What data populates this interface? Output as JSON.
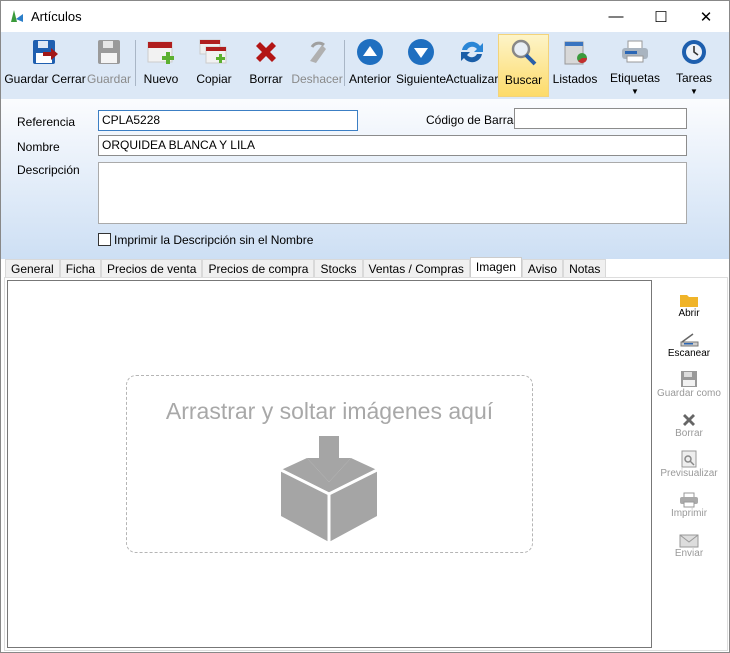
{
  "window": {
    "title": "Artículos",
    "minimize": "—",
    "maximize": "☐",
    "close": "✕"
  },
  "toolbar": [
    {
      "id": "guardar-cerrar",
      "label": "Guardar Cerrar",
      "enabled": true,
      "icon": "save-close-icon"
    },
    {
      "id": "guardar",
      "label": "Guardar",
      "enabled": false,
      "icon": "save-icon"
    },
    {
      "id": "nuevo",
      "label": "Nuevo",
      "enabled": true,
      "icon": "new-icon"
    },
    {
      "id": "copiar",
      "label": "Copiar",
      "enabled": true,
      "icon": "copy-icon"
    },
    {
      "id": "borrar",
      "label": "Borrar",
      "enabled": true,
      "icon": "delete-icon"
    },
    {
      "id": "deshacer",
      "label": "Deshacer",
      "enabled": false,
      "icon": "undo-icon"
    },
    {
      "id": "anterior",
      "label": "Anterior",
      "enabled": true,
      "icon": "arrow-up-icon"
    },
    {
      "id": "siguiente",
      "label": "Siguiente",
      "enabled": true,
      "icon": "arrow-down-icon"
    },
    {
      "id": "actualizar",
      "label": "Actualizar",
      "enabled": true,
      "icon": "refresh-icon"
    },
    {
      "id": "buscar",
      "label": "Buscar",
      "enabled": true,
      "active": true,
      "icon": "search-icon"
    },
    {
      "id": "listados",
      "label": "Listados",
      "enabled": true,
      "icon": "report-icon"
    },
    {
      "id": "etiquetas",
      "label": "Etiquetas",
      "enabled": true,
      "dropdown": true,
      "icon": "printer-icon"
    },
    {
      "id": "tareas",
      "label": "Tareas",
      "enabled": true,
      "dropdown": true,
      "icon": "clock-icon"
    }
  ],
  "form": {
    "referencia_label": "Referencia",
    "referencia_value": "CPLA5228",
    "codigo_barras_label": "Código de Barras",
    "codigo_barras_value": "",
    "nombre_label": "Nombre",
    "nombre_value": "ORQUIDEA BLANCA Y LILA",
    "descripcion_label": "Descripción",
    "descripcion_value": "",
    "imprimir_label": "Imprimir la Descripción sin el Nombre",
    "imprimir_checked": false
  },
  "tabs": [
    "General",
    "Ficha",
    "Precios de venta",
    "Precios de compra",
    "Stocks",
    "Ventas / Compras",
    "Imagen",
    "Aviso",
    "Notas"
  ],
  "selected_tab": "Imagen",
  "image_panel": {
    "drop_text": "Arrastrar y soltar imágenes aquí"
  },
  "side_actions": [
    {
      "label": "Abrir",
      "enabled": true,
      "icon": "folder-icon"
    },
    {
      "label": "Escanear",
      "enabled": true,
      "icon": "scanner-icon"
    },
    {
      "label": "Guardar como",
      "enabled": false,
      "icon": "save-as-icon"
    },
    {
      "label": "Borrar",
      "enabled": false,
      "icon": "delete-icon"
    },
    {
      "label": "Previsualizar",
      "enabled": false,
      "icon": "preview-icon"
    },
    {
      "label": "Imprimir",
      "enabled": false,
      "icon": "print-icon"
    },
    {
      "label": "Enviar",
      "enabled": false,
      "icon": "mail-icon"
    }
  ],
  "colors": {
    "toolbar_bg": "#dce8f6",
    "active_button": "#fddb6a",
    "nav_blue": "#1f6fc0",
    "delete_red": "#b31515"
  }
}
